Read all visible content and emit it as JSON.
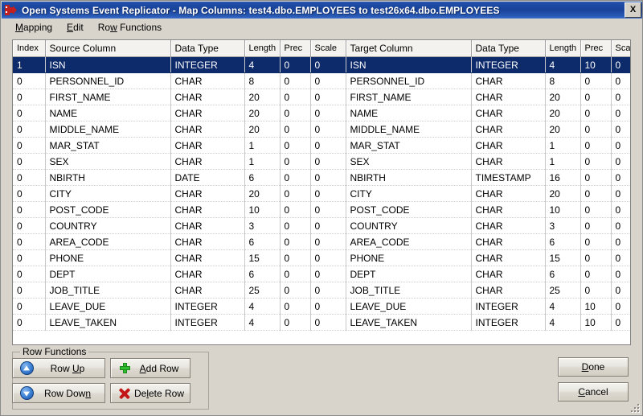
{
  "window": {
    "title": "Open Systems Event Replicator - Map Columns:   test4.dbo.EMPLOYEES  to  test26x64.dbo.EMPLOYEES",
    "app_name": "Open Systems Event Replicator",
    "dialog_name": "Map Columns",
    "source_table": "test4.dbo.EMPLOYEES",
    "target_table": "test26x64.dbo.EMPLOYEES",
    "close_label": "X",
    "icon": "replicator-icon",
    "titlebar_color": "#1a4299",
    "face_color": "#d8d4cc"
  },
  "menubar": {
    "items": [
      {
        "label": "Mapping",
        "accel": "M"
      },
      {
        "label": "Edit",
        "accel": "E"
      },
      {
        "label": "Row Functions",
        "accel": "w"
      }
    ]
  },
  "grid": {
    "headers": [
      "Index",
      "Source Column",
      "Data Type",
      "Length",
      "Prec",
      "Scale",
      "Target Column",
      "Data Type",
      "Length",
      "Prec",
      "Scale"
    ],
    "selected_row_index": 0,
    "selection_color": "#0d2a6b",
    "rows": [
      {
        "index": "1",
        "source_column": "ISN",
        "source_type": "INTEGER",
        "source_length": "4",
        "source_prec": "0",
        "source_scale": "0",
        "target_column": "ISN",
        "target_type": "INTEGER",
        "target_length": "4",
        "target_prec": "10",
        "target_scale": "0",
        "selected": true
      },
      {
        "index": "0",
        "source_column": "PERSONNEL_ID",
        "source_type": "CHAR",
        "source_length": "8",
        "source_prec": "0",
        "source_scale": "0",
        "target_column": "PERSONNEL_ID",
        "target_type": "CHAR",
        "target_length": "8",
        "target_prec": "0",
        "target_scale": "0",
        "selected": false
      },
      {
        "index": "0",
        "source_column": "FIRST_NAME",
        "source_type": "CHAR",
        "source_length": "20",
        "source_prec": "0",
        "source_scale": "0",
        "target_column": "FIRST_NAME",
        "target_type": "CHAR",
        "target_length": "20",
        "target_prec": "0",
        "target_scale": "0",
        "selected": false
      },
      {
        "index": "0",
        "source_column": "NAME",
        "source_type": "CHAR",
        "source_length": "20",
        "source_prec": "0",
        "source_scale": "0",
        "target_column": "NAME",
        "target_type": "CHAR",
        "target_length": "20",
        "target_prec": "0",
        "target_scale": "0",
        "selected": false
      },
      {
        "index": "0",
        "source_column": "MIDDLE_NAME",
        "source_type": "CHAR",
        "source_length": "20",
        "source_prec": "0",
        "source_scale": "0",
        "target_column": "MIDDLE_NAME",
        "target_type": "CHAR",
        "target_length": "20",
        "target_prec": "0",
        "target_scale": "0",
        "selected": false
      },
      {
        "index": "0",
        "source_column": "MAR_STAT",
        "source_type": "CHAR",
        "source_length": "1",
        "source_prec": "0",
        "source_scale": "0",
        "target_column": "MAR_STAT",
        "target_type": "CHAR",
        "target_length": "1",
        "target_prec": "0",
        "target_scale": "0",
        "selected": false
      },
      {
        "index": "0",
        "source_column": "SEX",
        "source_type": "CHAR",
        "source_length": "1",
        "source_prec": "0",
        "source_scale": "0",
        "target_column": "SEX",
        "target_type": "CHAR",
        "target_length": "1",
        "target_prec": "0",
        "target_scale": "0",
        "selected": false
      },
      {
        "index": "0",
        "source_column": "NBIRTH",
        "source_type": "DATE",
        "source_length": "6",
        "source_prec": "0",
        "source_scale": "0",
        "target_column": "NBIRTH",
        "target_type": "TIMESTAMP",
        "target_length": "16",
        "target_prec": "0",
        "target_scale": "0",
        "selected": false
      },
      {
        "index": "0",
        "source_column": "CITY",
        "source_type": "CHAR",
        "source_length": "20",
        "source_prec": "0",
        "source_scale": "0",
        "target_column": "CITY",
        "target_type": "CHAR",
        "target_length": "20",
        "target_prec": "0",
        "target_scale": "0",
        "selected": false
      },
      {
        "index": "0",
        "source_column": "POST_CODE",
        "source_type": "CHAR",
        "source_length": "10",
        "source_prec": "0",
        "source_scale": "0",
        "target_column": "POST_CODE",
        "target_type": "CHAR",
        "target_length": "10",
        "target_prec": "0",
        "target_scale": "0",
        "selected": false
      },
      {
        "index": "0",
        "source_column": "COUNTRY",
        "source_type": "CHAR",
        "source_length": "3",
        "source_prec": "0",
        "source_scale": "0",
        "target_column": "COUNTRY",
        "target_type": "CHAR",
        "target_length": "3",
        "target_prec": "0",
        "target_scale": "0",
        "selected": false
      },
      {
        "index": "0",
        "source_column": "AREA_CODE",
        "source_type": "CHAR",
        "source_length": "6",
        "source_prec": "0",
        "source_scale": "0",
        "target_column": "AREA_CODE",
        "target_type": "CHAR",
        "target_length": "6",
        "target_prec": "0",
        "target_scale": "0",
        "selected": false
      },
      {
        "index": "0",
        "source_column": "PHONE",
        "source_type": "CHAR",
        "source_length": "15",
        "source_prec": "0",
        "source_scale": "0",
        "target_column": "PHONE",
        "target_type": "CHAR",
        "target_length": "15",
        "target_prec": "0",
        "target_scale": "0",
        "selected": false
      },
      {
        "index": "0",
        "source_column": "DEPT",
        "source_type": "CHAR",
        "source_length": "6",
        "source_prec": "0",
        "source_scale": "0",
        "target_column": "DEPT",
        "target_type": "CHAR",
        "target_length": "6",
        "target_prec": "0",
        "target_scale": "0",
        "selected": false
      },
      {
        "index": "0",
        "source_column": "JOB_TITLE",
        "source_type": "CHAR",
        "source_length": "25",
        "source_prec": "0",
        "source_scale": "0",
        "target_column": "JOB_TITLE",
        "target_type": "CHAR",
        "target_length": "25",
        "target_prec": "0",
        "target_scale": "0",
        "selected": false
      },
      {
        "index": "0",
        "source_column": "LEAVE_DUE",
        "source_type": "INTEGER",
        "source_length": "4",
        "source_prec": "0",
        "source_scale": "0",
        "target_column": "LEAVE_DUE",
        "target_type": "INTEGER",
        "target_length": "4",
        "target_prec": "10",
        "target_scale": "0",
        "selected": false
      },
      {
        "index": "0",
        "source_column": "LEAVE_TAKEN",
        "source_type": "INTEGER",
        "source_length": "4",
        "source_prec": "0",
        "source_scale": "0",
        "target_column": "LEAVE_TAKEN",
        "target_type": "INTEGER",
        "target_length": "4",
        "target_prec": "10",
        "target_scale": "0",
        "selected": false
      }
    ]
  },
  "row_functions": {
    "group_label": "Row Functions",
    "buttons": [
      {
        "label": "Row Up",
        "accel": "U",
        "icon": "arrow-up-circle-icon"
      },
      {
        "label": "Add Row",
        "accel": "A",
        "icon": "plus-icon"
      },
      {
        "label": "Row Down",
        "accel": "n",
        "icon": "arrow-down-circle-icon"
      },
      {
        "label": "Delete Row",
        "accel": "l",
        "icon": "red-x-icon"
      }
    ]
  },
  "dialog_buttons": {
    "done": {
      "label": "Done",
      "accel": "D"
    },
    "cancel": {
      "label": "Cancel",
      "accel": "C"
    }
  }
}
